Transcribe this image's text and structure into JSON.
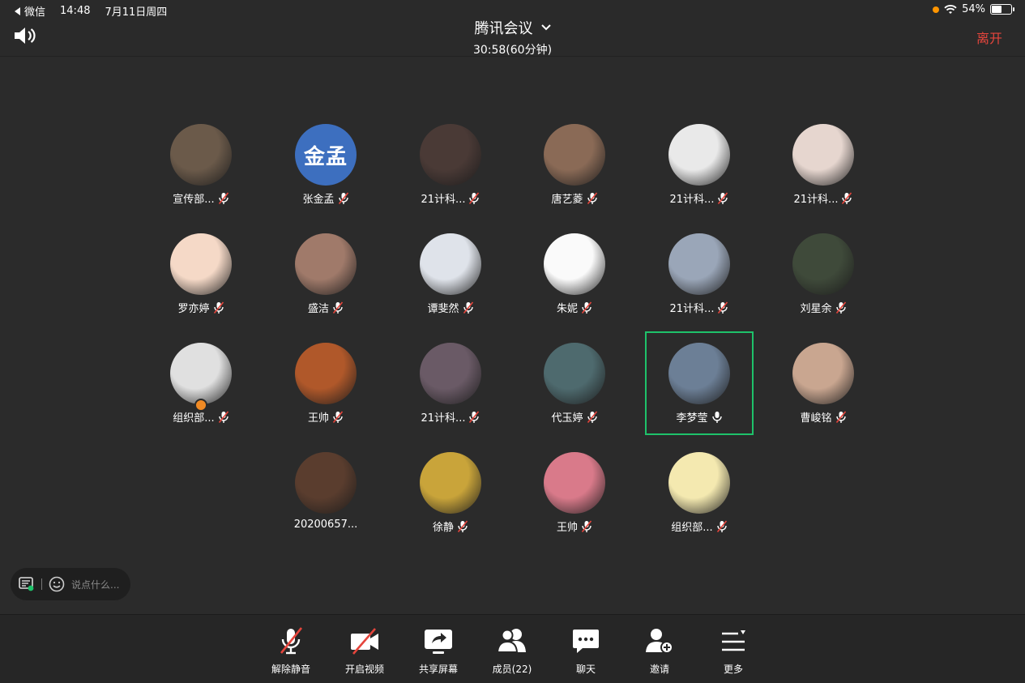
{
  "status_bar": {
    "back_app": "微信",
    "time": "14:48",
    "date": "7月11日周四",
    "battery_percent": "54%",
    "battery_level": 0.54
  },
  "header": {
    "title": "腾讯会议",
    "timer": "30:58(60分钟)",
    "leave_label": "离开"
  },
  "participants": [
    {
      "name": "宣传部...",
      "muted": true,
      "color": "#6b5a4a",
      "icon": "bear-photo"
    },
    {
      "name": "张金孟",
      "muted": true,
      "color": "#3d6fbf",
      "avatar_text": "金孟"
    },
    {
      "name": "21计科...",
      "muted": true,
      "color": "#4a3a36",
      "icon": "person-photo"
    },
    {
      "name": "唐艺菱",
      "muted": true,
      "color": "#8a6a56",
      "icon": "person-photo"
    },
    {
      "name": "21计科...",
      "muted": true,
      "color": "#e9e9e9",
      "icon": "document-photo"
    },
    {
      "name": "21计科...",
      "muted": true,
      "color": "#e6d6cf",
      "icon": "illustration"
    },
    {
      "name": "罗亦婷",
      "muted": true,
      "color": "#f5d9c7",
      "icon": "tiger-cartoon"
    },
    {
      "name": "盛洁",
      "muted": true,
      "color": "#a07a6a",
      "icon": "child-photo"
    },
    {
      "name": "谭斐然",
      "muted": true,
      "color": "#dfe3ea",
      "icon": "anime-character"
    },
    {
      "name": "朱妮",
      "muted": true,
      "color": "#fafafa",
      "icon": "cute-cartoon"
    },
    {
      "name": "21计科...",
      "muted": true,
      "color": "#9aa6b8",
      "icon": "blurred-photo"
    },
    {
      "name": "刘星余",
      "muted": true,
      "color": "#3f4a3a",
      "icon": "flower-photo"
    },
    {
      "name": "组织部...",
      "muted": true,
      "color": "#e0e0e0",
      "icon": "anime-character",
      "host": true
    },
    {
      "name": "王帅",
      "muted": true,
      "color": "#b0582a",
      "icon": "person-photo"
    },
    {
      "name": "21计科...",
      "muted": true,
      "color": "#6a5a66",
      "icon": "illustration"
    },
    {
      "name": "代玉婷",
      "muted": true,
      "color": "#4e6a6e",
      "icon": "person-photo"
    },
    {
      "name": "李梦莹",
      "muted": false,
      "color": "#6c7f96",
      "icon": "landscape-photo",
      "active": true
    },
    {
      "name": "曹峻铭",
      "muted": true,
      "color": "#c9a690",
      "icon": "person-photo"
    },
    {
      "name": "20200657...",
      "muted": null,
      "color": "#5a3d2e",
      "icon": "feather-photo"
    },
    {
      "name": "徐静",
      "muted": true,
      "color": "#c9a43a",
      "icon": "meme-photo"
    },
    {
      "name": "王帅",
      "muted": true,
      "color": "#d97a8a",
      "icon": "melody-cartoon"
    },
    {
      "name": "组织部...",
      "muted": true,
      "color": "#f4e9b0",
      "icon": "duck-cartoon"
    }
  ],
  "chat": {
    "placeholder": "说点什么..."
  },
  "toolbar": {
    "items": [
      {
        "label": "解除静音",
        "icon": "mic-off-icon"
      },
      {
        "label": "开启视频",
        "icon": "video-off-icon"
      },
      {
        "label": "共享屏幕",
        "icon": "share-screen-icon"
      },
      {
        "label": "成员(22)",
        "icon": "members-icon"
      },
      {
        "label": "聊天",
        "icon": "chat-icon"
      },
      {
        "label": "邀请",
        "icon": "invite-icon"
      },
      {
        "label": "更多",
        "icon": "more-icon"
      }
    ]
  },
  "colors": {
    "background": "#2b2b2b",
    "leave": "#e5453c",
    "active_border": "#1ec26a",
    "mute_red": "#e5453c"
  }
}
